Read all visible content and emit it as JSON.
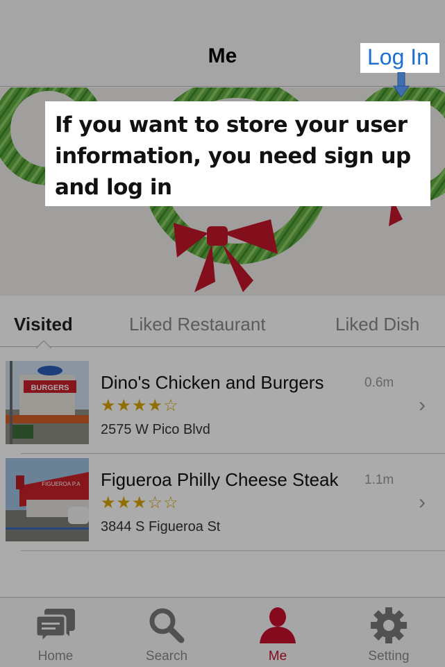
{
  "nav": {
    "title": "Me",
    "login": "Log In"
  },
  "tutorial": {
    "text": "If you want to store your user information, you need sign up and log in"
  },
  "tabs": [
    {
      "label": "Visited",
      "active": true
    },
    {
      "label": "Liked Restaurant",
      "active": false
    },
    {
      "label": "Liked Dish",
      "active": false
    }
  ],
  "restaurants": [
    {
      "name": "Dino's Chicken and Burgers",
      "distance": "0.6m",
      "rating": 4,
      "stars": "★★★★☆",
      "address": "2575 W Pico Blvd",
      "thumb_sign": "BURGERS"
    },
    {
      "name": "Figueroa Philly Cheese Steak",
      "distance": "1.1m",
      "rating": 3,
      "stars": "★★★☆☆",
      "address": "3844 S Figueroa St",
      "thumb_sign": "FIGUEROA P.A"
    }
  ],
  "tabbar": [
    {
      "label": "Home",
      "icon": "chat-bubbles-icon",
      "active": false
    },
    {
      "label": "Search",
      "icon": "magnifier-icon",
      "active": false
    },
    {
      "label": "Me",
      "icon": "person-icon",
      "active": true
    },
    {
      "label": "Setting",
      "icon": "gear-icon",
      "active": false
    }
  ],
  "colors": {
    "accent": "#c8102e",
    "link": "#1e6fd0",
    "star": "#d8a400",
    "wreath": "#5aa83c",
    "bow": "#c4162a"
  }
}
